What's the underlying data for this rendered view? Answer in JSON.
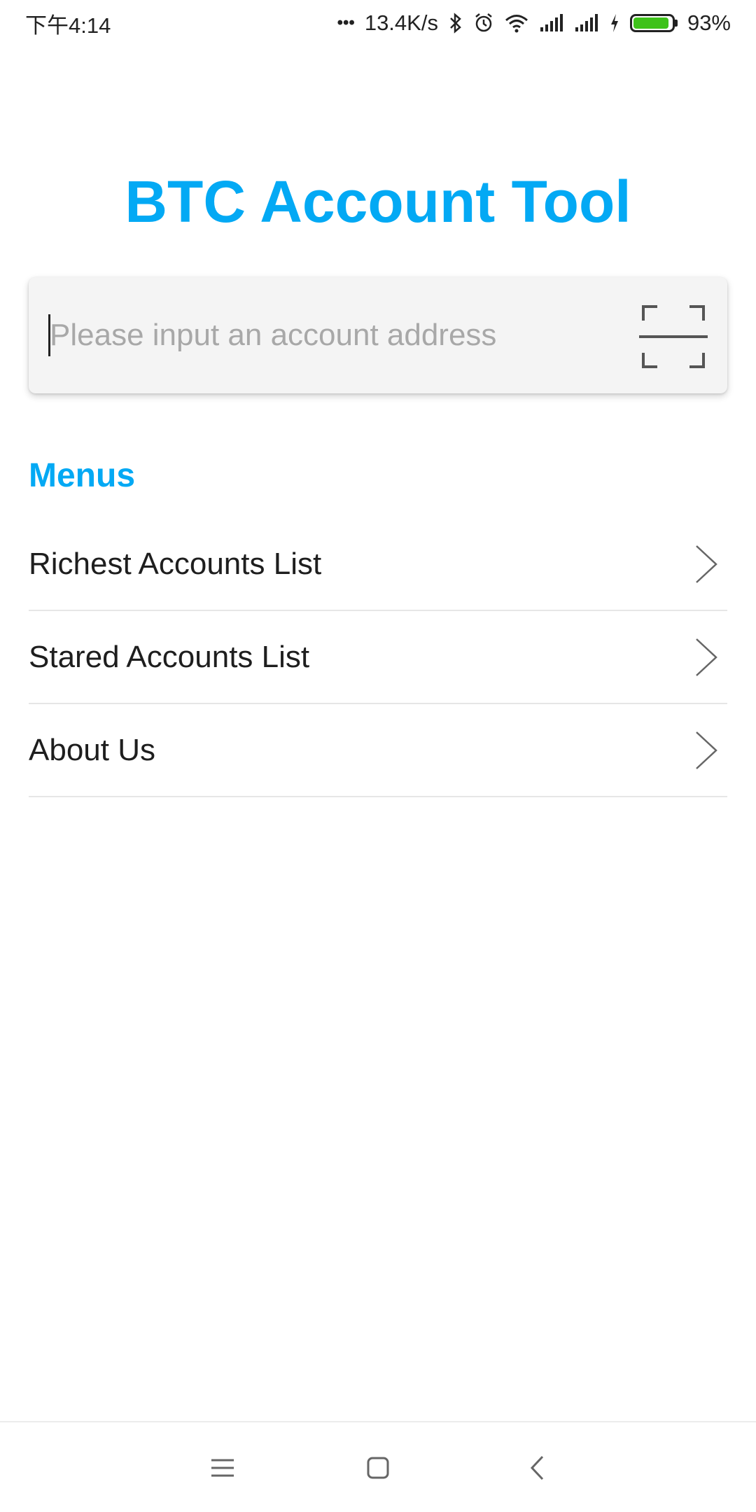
{
  "status_bar": {
    "time": "下午4:14",
    "dots": "•••",
    "network_speed": "13.4K/s",
    "battery_percent": "93%",
    "battery_level": 0.93,
    "icons": [
      "bluetooth-icon",
      "alarm-icon",
      "wifi-icon",
      "signal-icon",
      "signal-icon",
      "charging-icon",
      "battery-icon"
    ]
  },
  "app": {
    "title": "BTC Account Tool",
    "accent_color": "#03a9f4"
  },
  "search": {
    "value": "",
    "placeholder": "Please input an account address",
    "scan_icon": "scan-icon"
  },
  "menus": {
    "heading": "Menus",
    "items": [
      {
        "label": "Richest Accounts List",
        "icon": "chevron-right-icon"
      },
      {
        "label": "Stared Accounts List",
        "icon": "chevron-right-icon"
      },
      {
        "label": "About Us",
        "icon": "chevron-right-icon"
      }
    ]
  },
  "nav_bar": {
    "icons": [
      "menu-icon",
      "home-icon",
      "back-icon"
    ]
  }
}
